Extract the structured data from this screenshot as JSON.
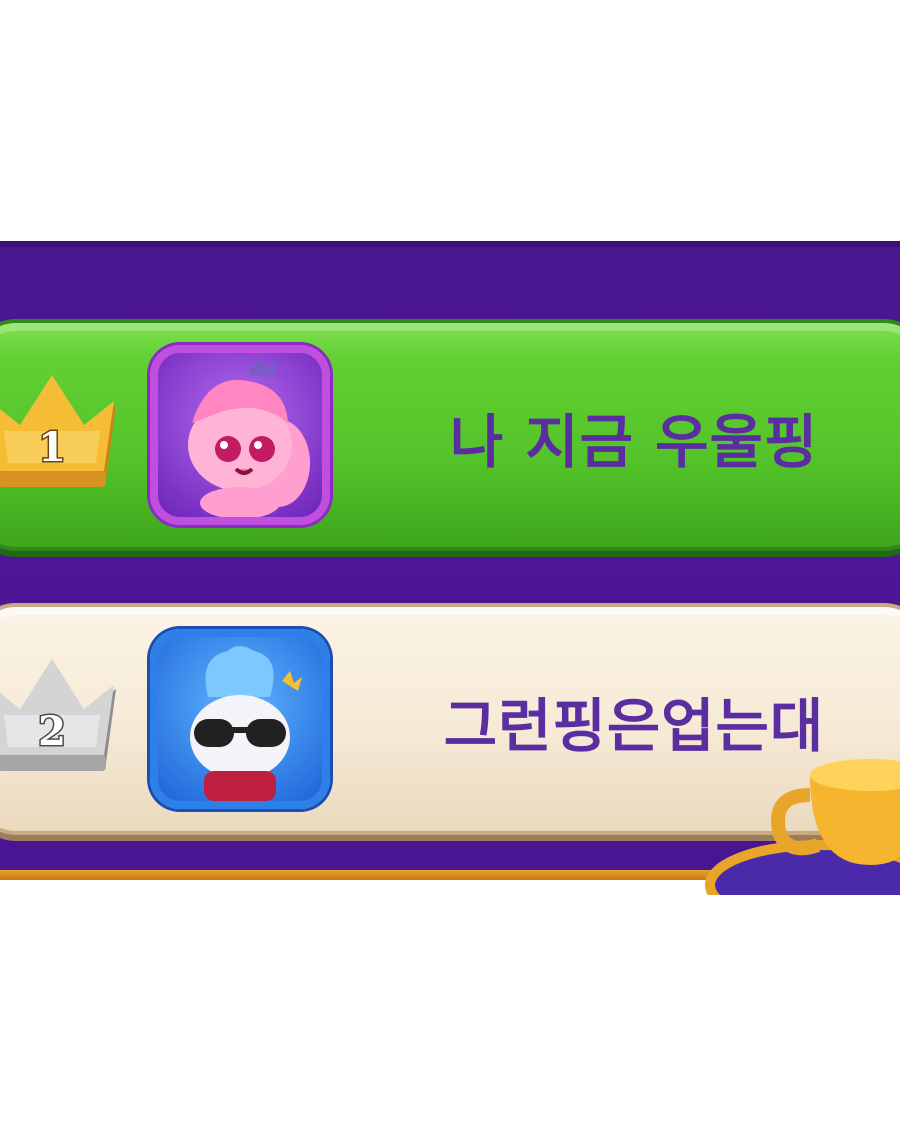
{
  "leaderboard": {
    "entries": [
      {
        "rank": "1",
        "name": "나 지금 우울핑",
        "rank_badge": "gold-crown",
        "avatar": "pink-character-avatar",
        "row_color": "#55c42b"
      },
      {
        "rank": "2",
        "name": "그런핑은업는대",
        "rank_badge": "silver-crown",
        "avatar": "blue-character-avatar",
        "row_color": "#f6ead6"
      }
    ],
    "decoration": "gold-trophy-icon",
    "colors": {
      "panel": "#4f1798",
      "name_text": "#5a2da0",
      "gold": "#f2b733",
      "silver": "#c9c9c9"
    }
  }
}
